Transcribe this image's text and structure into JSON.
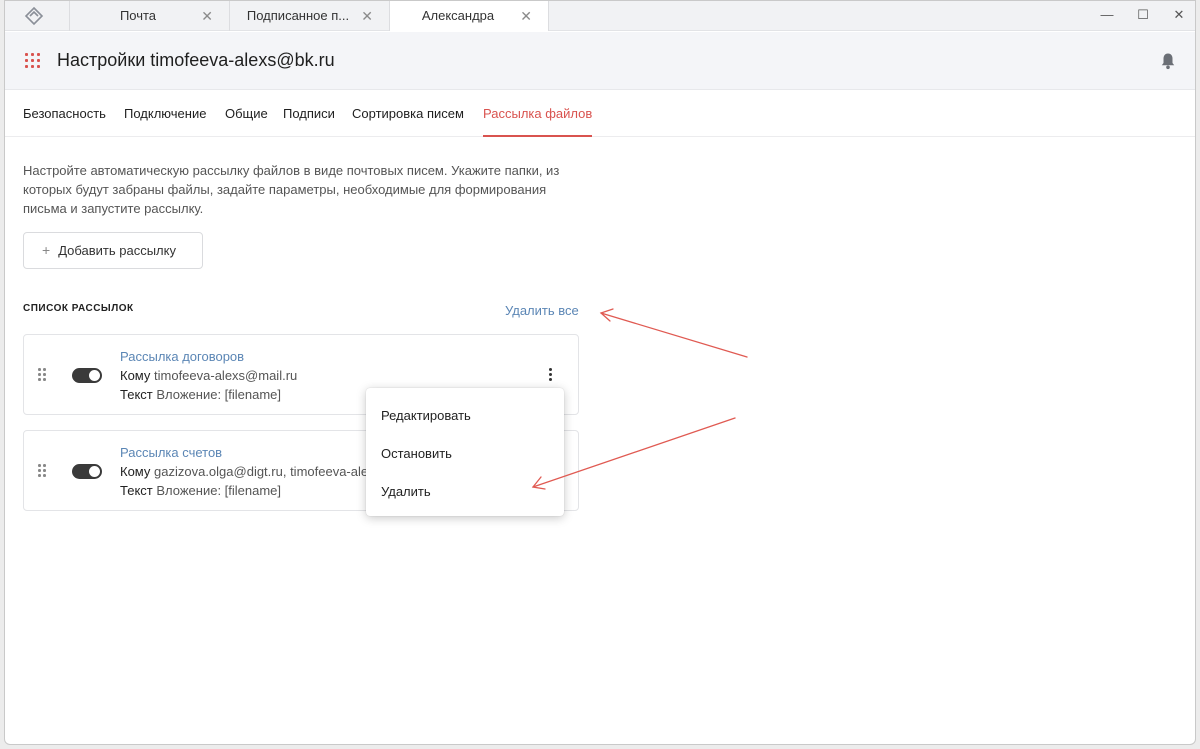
{
  "tabs": [
    {
      "label": "Почта",
      "close": "✕"
    },
    {
      "label": "Подписанное п...",
      "close": "✕"
    },
    {
      "label": "Александра",
      "close": "✕"
    }
  ],
  "window_controls": {
    "minimize": "—",
    "maximize": "☐",
    "close": "✕"
  },
  "header": {
    "title": "Настройки timofeeva-alexs@bk.ru"
  },
  "settings_tabs": [
    {
      "label": "Безопасность",
      "active": false
    },
    {
      "label": "Подключение",
      "active": false
    },
    {
      "label": "Общие",
      "active": false
    },
    {
      "label": "Подписи",
      "active": false
    },
    {
      "label": "Сортировка писем",
      "active": false
    },
    {
      "label": "Рассылка файлов",
      "active": true
    }
  ],
  "description": "Настройте автоматическую рассылку файлов в виде почтовых писем. Укажите папки, из которых будут забраны файлы, задайте параметры, необходимые для формирования письма и запустите рассылку.",
  "add_button": {
    "icon": "+",
    "label": "Добавить рассылку"
  },
  "mailing_list": {
    "section_label": "СПИСОК РАССЫЛОК",
    "delete_all": "Удалить все",
    "items": [
      {
        "title": "Рассылка договоров",
        "to_label": "Кому",
        "to_value": "timofeeva-alexs@mail.ru",
        "text_label": "Текст",
        "text_value": "Вложение: [filename]",
        "enabled": true
      },
      {
        "title": "Рассылка счетов",
        "to_label": "Кому",
        "to_value": "gazizova.olga@digt.ru, timofeeva-alexs@mail.ru",
        "text_label": "Текст",
        "text_value": "Вложение: [filename]",
        "enabled": true
      }
    ]
  },
  "context_menu": {
    "items": [
      "Редактировать",
      "Остановить",
      "Удалить"
    ]
  },
  "colors": {
    "accent": "#d9534f",
    "link": "#5b86b5",
    "annotation_arrow": "#e05a52"
  }
}
